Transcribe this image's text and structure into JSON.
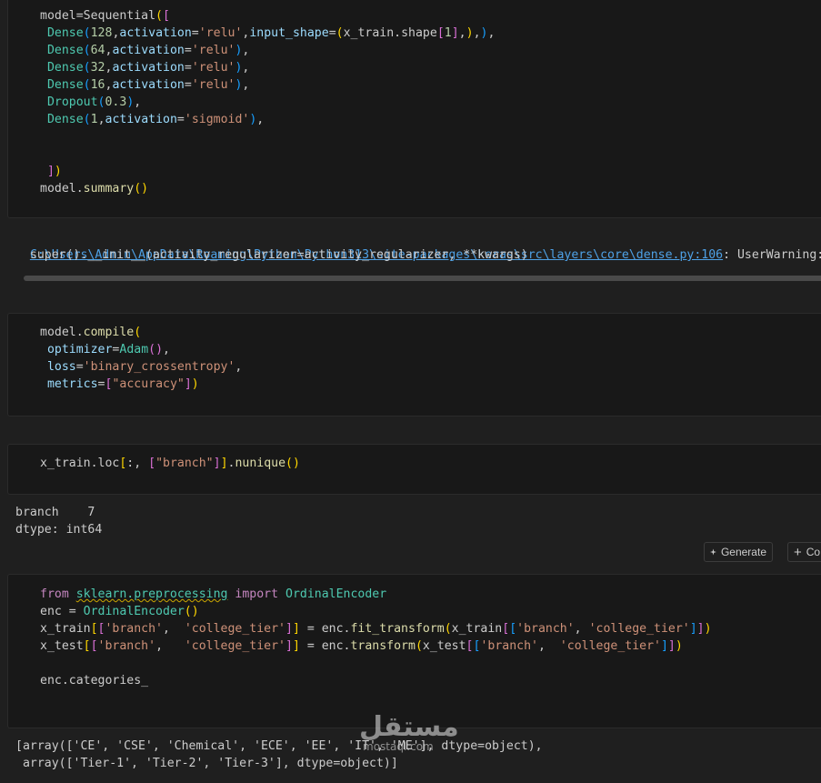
{
  "cell1": {
    "lines": [
      [
        [
          "",
          "model=Sequential"
        ],
        [
          "b1",
          "("
        ],
        [
          "b2",
          "["
        ]
      ],
      [
        [
          "",
          " "
        ],
        [
          "cls",
          "Dense"
        ],
        [
          "b3",
          "("
        ],
        [
          "num",
          "128"
        ],
        [
          "",
          ","
        ],
        [
          "par",
          "activation"
        ],
        [
          "",
          "="
        ],
        [
          "str",
          "'relu'"
        ],
        [
          "",
          ","
        ],
        [
          "par",
          "input_shape"
        ],
        [
          "",
          "="
        ],
        [
          "b1",
          "("
        ],
        [
          "",
          "x_train.shape"
        ],
        [
          "b2",
          "["
        ],
        [
          "num",
          "1"
        ],
        [
          "b2",
          "]"
        ],
        [
          "",
          ","
        ],
        [
          "b1",
          ")"
        ],
        [
          "",
          ","
        ],
        [
          "b3",
          ")"
        ],
        [
          "",
          ","
        ]
      ],
      [
        [
          "",
          " "
        ],
        [
          "cls",
          "Dense"
        ],
        [
          "b3",
          "("
        ],
        [
          "num",
          "64"
        ],
        [
          "",
          ","
        ],
        [
          "par",
          "activation"
        ],
        [
          "",
          "="
        ],
        [
          "str",
          "'relu'"
        ],
        [
          "b3",
          ")"
        ],
        [
          "",
          ","
        ]
      ],
      [
        [
          "",
          " "
        ],
        [
          "cls",
          "Dense"
        ],
        [
          "b3",
          "("
        ],
        [
          "num",
          "32"
        ],
        [
          "",
          ","
        ],
        [
          "par",
          "activation"
        ],
        [
          "",
          "="
        ],
        [
          "str",
          "'relu'"
        ],
        [
          "b3",
          ")"
        ],
        [
          "",
          ","
        ]
      ],
      [
        [
          "",
          " "
        ],
        [
          "cls",
          "Dense"
        ],
        [
          "b3",
          "("
        ],
        [
          "num",
          "16"
        ],
        [
          "",
          ","
        ],
        [
          "par",
          "activation"
        ],
        [
          "",
          "="
        ],
        [
          "str",
          "'relu'"
        ],
        [
          "b3",
          ")"
        ],
        [
          "",
          ","
        ]
      ],
      [
        [
          "",
          " "
        ],
        [
          "cls",
          "Dropout"
        ],
        [
          "b3",
          "("
        ],
        [
          "num",
          "0.3"
        ],
        [
          "b3",
          ")"
        ],
        [
          "",
          ","
        ]
      ],
      [
        [
          "",
          " "
        ],
        [
          "cls",
          "Dense"
        ],
        [
          "b3",
          "("
        ],
        [
          "num",
          "1"
        ],
        [
          "",
          ","
        ],
        [
          "par",
          "activation"
        ],
        [
          "",
          "="
        ],
        [
          "str",
          "'sigmoid'"
        ],
        [
          "b3",
          ")"
        ],
        [
          "",
          ","
        ]
      ],
      [],
      [],
      [
        [
          "",
          " "
        ],
        [
          "b2",
          "]"
        ],
        [
          "b1",
          ")"
        ]
      ],
      [
        [
          "",
          "model."
        ],
        [
          "fn",
          "summary"
        ],
        [
          "b1",
          "()"
        ]
      ]
    ]
  },
  "output1": {
    "warning_path": "C:\\Users\\Admin\\AppData\\Roaming\\Python\\Python313\\site-packages\\keras\\src\\layers\\core\\dense.py:106",
    "warning_text": ": UserWarning: Do n",
    "line2": "  super().__init__(activity_regularizer=activity_regularizer, **kwargs)"
  },
  "cell2": {
    "lines": [
      [
        [
          "",
          "model."
        ],
        [
          "fn",
          "compile"
        ],
        [
          "b1",
          "("
        ]
      ],
      [
        [
          "",
          " "
        ],
        [
          "par",
          "optimizer"
        ],
        [
          "",
          "="
        ],
        [
          "cls",
          "Adam"
        ],
        [
          "b2",
          "()"
        ],
        [
          "",
          ","
        ]
      ],
      [
        [
          "",
          " "
        ],
        [
          "par",
          "loss"
        ],
        [
          "",
          "="
        ],
        [
          "str",
          "'binary_crossentropy'"
        ],
        [
          "",
          ","
        ]
      ],
      [
        [
          "",
          " "
        ],
        [
          "par",
          "metrics"
        ],
        [
          "",
          "="
        ],
        [
          "b2",
          "["
        ],
        [
          "str",
          "\"accuracy\""
        ],
        [
          "b2",
          "]"
        ],
        [
          "b1",
          ")"
        ]
      ]
    ]
  },
  "cell3": {
    "lines": [
      [
        [
          "",
          "x_train.loc"
        ],
        [
          "b1",
          "["
        ],
        [
          "",
          ":, "
        ],
        [
          "b2",
          "["
        ],
        [
          "str",
          "\"branch\""
        ],
        [
          "b2",
          "]"
        ],
        [
          "b1",
          "]"
        ],
        [
          "",
          "."
        ],
        [
          "fn",
          "nunique"
        ],
        [
          "b1",
          "()"
        ]
      ]
    ]
  },
  "output3": {
    "line1": "branch    7",
    "line2": "dtype: int64"
  },
  "toolbar": {
    "generate_label": "Generate",
    "code_label": "Co"
  },
  "cell4": {
    "lines": [
      [
        [
          "kw",
          "from"
        ],
        [
          "",
          " "
        ],
        [
          "cls squig",
          "sklearn.preprocessing"
        ],
        [
          "",
          " "
        ],
        [
          "kw",
          "import"
        ],
        [
          "",
          " "
        ],
        [
          "cls",
          "OrdinalEncoder"
        ]
      ],
      [
        [
          "",
          "enc = "
        ],
        [
          "cls",
          "OrdinalEncoder"
        ],
        [
          "b1",
          "()"
        ]
      ],
      [
        [
          "",
          "x_train"
        ],
        [
          "b1",
          "["
        ],
        [
          "b2",
          "["
        ],
        [
          "str",
          "'branch'"
        ],
        [
          "",
          ",  "
        ],
        [
          "str",
          "'college_tier'"
        ],
        [
          "b2",
          "]"
        ],
        [
          "b1",
          "]"
        ],
        [
          "",
          " = enc."
        ],
        [
          "fn",
          "fit_transform"
        ],
        [
          "b1",
          "("
        ],
        [
          "",
          "x_train"
        ],
        [
          "b2",
          "["
        ],
        [
          "b3",
          "["
        ],
        [
          "str",
          "'branch'"
        ],
        [
          "",
          ", "
        ],
        [
          "str",
          "'college_tier'"
        ],
        [
          "b3",
          "]"
        ],
        [
          "b2",
          "]"
        ],
        [
          "b1",
          ")"
        ]
      ],
      [
        [
          "",
          "x_test"
        ],
        [
          "b1",
          "["
        ],
        [
          "b2",
          "["
        ],
        [
          "str",
          "'branch'"
        ],
        [
          "",
          ",   "
        ],
        [
          "str",
          "'college_tier'"
        ],
        [
          "b2",
          "]"
        ],
        [
          "b1",
          "]"
        ],
        [
          "",
          " = enc."
        ],
        [
          "fn",
          "transform"
        ],
        [
          "b1",
          "("
        ],
        [
          "",
          "x_test"
        ],
        [
          "b2",
          "["
        ],
        [
          "b3",
          "["
        ],
        [
          "str",
          "'branch'"
        ],
        [
          "",
          ",  "
        ],
        [
          "str",
          "'college_tier'"
        ],
        [
          "b3",
          "]"
        ],
        [
          "b2",
          "]"
        ],
        [
          "b1",
          ")"
        ]
      ],
      [],
      [
        [
          "",
          "enc.categories_"
        ]
      ]
    ]
  },
  "output4": {
    "line1": "[array(['CE', 'CSE', 'Chemical', 'ECE', 'EE', 'IT', 'ME'], dtype=object),",
    "line2": " array(['Tier-1', 'Tier-2', 'Tier-3'], dtype=object)]"
  },
  "watermark": {
    "arabic": "مستقل",
    "latin": "mostaql.com"
  }
}
